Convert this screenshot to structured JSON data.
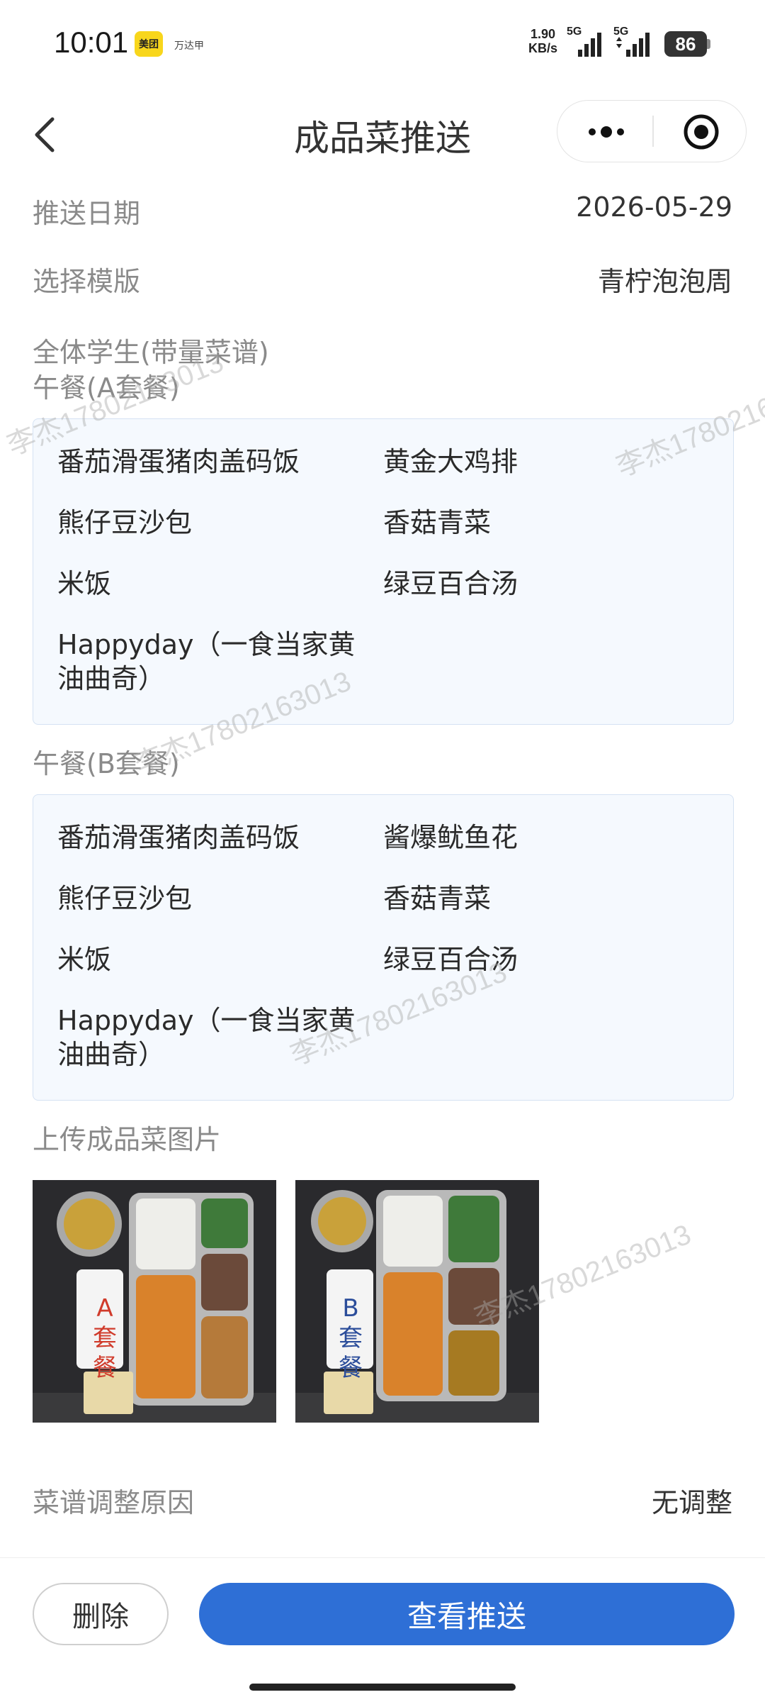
{
  "status_bar": {
    "time": "10:01",
    "app_badge": "美团",
    "app_mini": "万达甲",
    "net_speed_value": "1.90",
    "net_speed_unit": "KB/s",
    "sig1": "5G",
    "sig2": "5G",
    "battery": "86"
  },
  "nav": {
    "title": "成品菜推送"
  },
  "form": {
    "push_date_label": "推送日期",
    "push_date_value": "2026-05-29",
    "template_label": "选择模版",
    "template_value": "青柠泡泡周",
    "audience_label": "全体学生(带量菜谱)"
  },
  "menu_a": {
    "title": "午餐(A套餐)",
    "left": [
      "番茄滑蛋猪肉盖码饭",
      "熊仔豆沙包",
      "米饭",
      "Happyday（一食当家黄油曲奇）"
    ],
    "right": [
      "黄金大鸡排",
      "香菇青菜",
      "绿豆百合汤"
    ]
  },
  "menu_b": {
    "title": "午餐(B套餐)",
    "left": [
      "番茄滑蛋猪肉盖码饭",
      "熊仔豆沙包",
      "米饭",
      "Happyday（一食当家黄油曲奇）"
    ],
    "right": [
      "酱爆鱿鱼花",
      "香菇青菜",
      "绿豆百合汤"
    ]
  },
  "photos": {
    "label": "上传成品菜图片",
    "items": [
      {
        "tag_line1": "A",
        "tag_line2": "套",
        "tag_line3": "餐"
      },
      {
        "tag_line1": "B",
        "tag_line2": "套",
        "tag_line3": "餐"
      }
    ]
  },
  "adjust": {
    "label": "菜谱调整原因",
    "value": "无调整"
  },
  "actions": {
    "delete": "删除",
    "view_push": "查看推送"
  },
  "watermark": "李杰17802163013"
}
